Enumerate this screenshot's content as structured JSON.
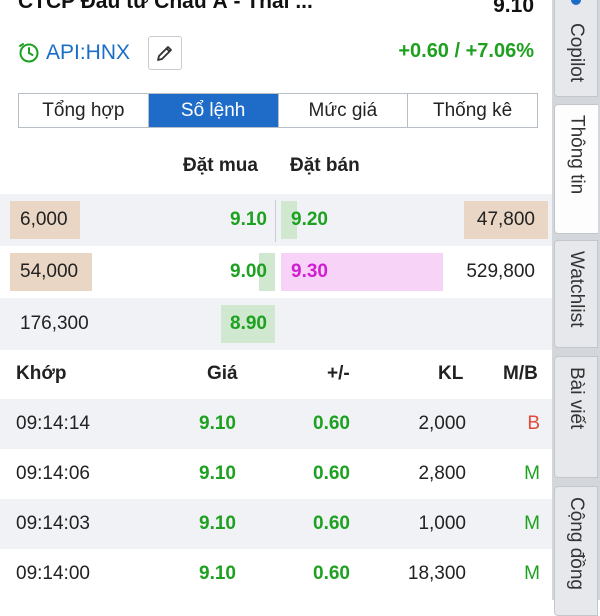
{
  "header": {
    "company": "CTCP Đầu tư Châu Á - Thái ...",
    "price": "9.10",
    "exchange": "API:HNX",
    "change": "+0.60 / +7.06%"
  },
  "tabs": [
    {
      "label": "Tổng hợp"
    },
    {
      "label": "Sổ lệnh"
    },
    {
      "label": "Mức giá"
    },
    {
      "label": "Thống kê"
    }
  ],
  "orderbook": {
    "bid_header": "Đặt mua",
    "ask_header": "Đặt bán",
    "rows": [
      {
        "bid_vol": "6,000",
        "bid_price": "9.10",
        "ask_price": "9.20",
        "ask_vol": "47,800"
      },
      {
        "bid_vol": "54,000",
        "bid_price": "9.00",
        "ask_price": "9.30",
        "ask_vol": "529,800"
      },
      {
        "bid_vol": "176,300",
        "bid_price": "8.90",
        "ask_price": "",
        "ask_vol": ""
      }
    ]
  },
  "trades": {
    "headers": {
      "time": "Khớp",
      "price": "Giá",
      "change": "+/-",
      "volume": "KL",
      "side": "M/B"
    },
    "rows": [
      {
        "time": "09:14:14",
        "price": "9.10",
        "change": "0.60",
        "volume": "2,000",
        "side": "B"
      },
      {
        "time": "09:14:06",
        "price": "9.10",
        "change": "0.60",
        "volume": "2,800",
        "side": "M"
      },
      {
        "time": "09:14:03",
        "price": "9.10",
        "change": "0.60",
        "volume": "1,000",
        "side": "M"
      },
      {
        "time": "09:14:00",
        "price": "9.10",
        "change": "0.60",
        "volume": "18,300",
        "side": "M"
      }
    ]
  },
  "side_tabs": [
    {
      "label": "Copilot"
    },
    {
      "label": "Thông tin"
    },
    {
      "label": "Watchlist"
    },
    {
      "label": "Bài viết"
    },
    {
      "label": "Cộng đồng"
    }
  ],
  "icons": {
    "clock": "clock-icon",
    "edit": "pencil-icon",
    "copilot": "copilot-icon"
  },
  "colors": {
    "up": "#1ea121",
    "ceiling": "#d21ed2",
    "accent": "#1e6cc8",
    "buy_side": "#e04a3a"
  }
}
